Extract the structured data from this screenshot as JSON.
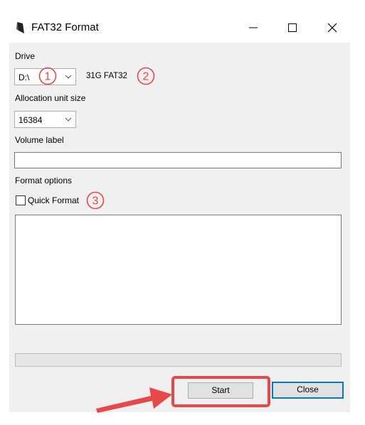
{
  "window": {
    "title": "FAT32 Format",
    "controls": {
      "minimize": "minimize-icon",
      "maximize": "maximize-icon",
      "close": "close-icon"
    }
  },
  "form": {
    "drive_label": "Drive",
    "drive_value": "D:\\",
    "drive_info": "31G FAT32",
    "allocation_label": "Allocation unit size",
    "allocation_value": "16384",
    "volume_label": "Volume label",
    "volume_value": "",
    "format_options_label": "Format options",
    "quick_format_label": "Quick Format",
    "quick_format_checked": false,
    "log_text": "",
    "progress": 0
  },
  "buttons": {
    "start": "Start",
    "close": "Close"
  },
  "annotations": {
    "marker_1": "①",
    "marker_2": "②",
    "marker_3": "③",
    "highlight_color": "#e84848"
  },
  "colors": {
    "client_bg": "#f0f0f0",
    "focus_border": "#0078d7",
    "annotation_red": "#e84848"
  }
}
